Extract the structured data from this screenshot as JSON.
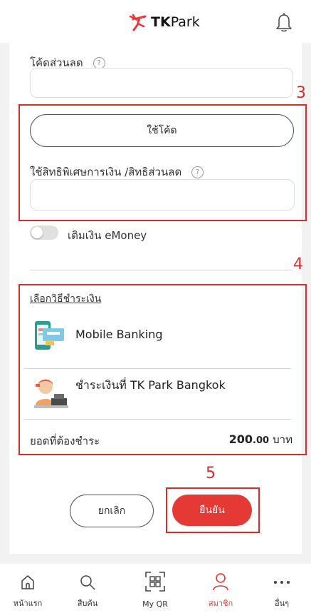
{
  "header": {
    "logo_tk": "TK",
    "logo_park": "Park",
    "brand_color": "#e53935"
  },
  "discount": {
    "label": "โค้ดส่วนลด",
    "help": "?",
    "value": "",
    "use_code_button": "ใช้โค้ด"
  },
  "privilege": {
    "label": "ใช้สิทธิพิเศษการเงิน /สิทธิส่วนลด",
    "help": "?",
    "value": ""
  },
  "emoney": {
    "label": "เติมเงิน eMoney",
    "enabled": false
  },
  "payment": {
    "title": "เลือกวิธีชำระเงิน",
    "methods": [
      {
        "label": "Mobile Banking",
        "icon": "mobile-banking-icon"
      },
      {
        "label": "ชำระเงินที่ TK Park Bangkok",
        "icon": "cashier-icon"
      }
    ],
    "total_label": "ยอดที่ต้องชำระ",
    "total_amount": "200",
    "total_decimals": ".00",
    "total_unit": "บาท"
  },
  "actions": {
    "cancel": "ยกเลิก",
    "confirm": "ยืนยัน"
  },
  "annotations": {
    "n3": "3",
    "n4": "4",
    "n5": "5",
    "color": "#d32f2f"
  },
  "nav": {
    "items": [
      {
        "label": "หน้าแรก",
        "icon": "home-icon"
      },
      {
        "label": "สืบค้น",
        "icon": "search-icon"
      },
      {
        "label": "My QR",
        "icon": "qr-icon"
      },
      {
        "label": "สมาชิก",
        "icon": "member-icon",
        "active": true
      },
      {
        "label": "อื่นๆ",
        "icon": "more-icon"
      }
    ]
  }
}
